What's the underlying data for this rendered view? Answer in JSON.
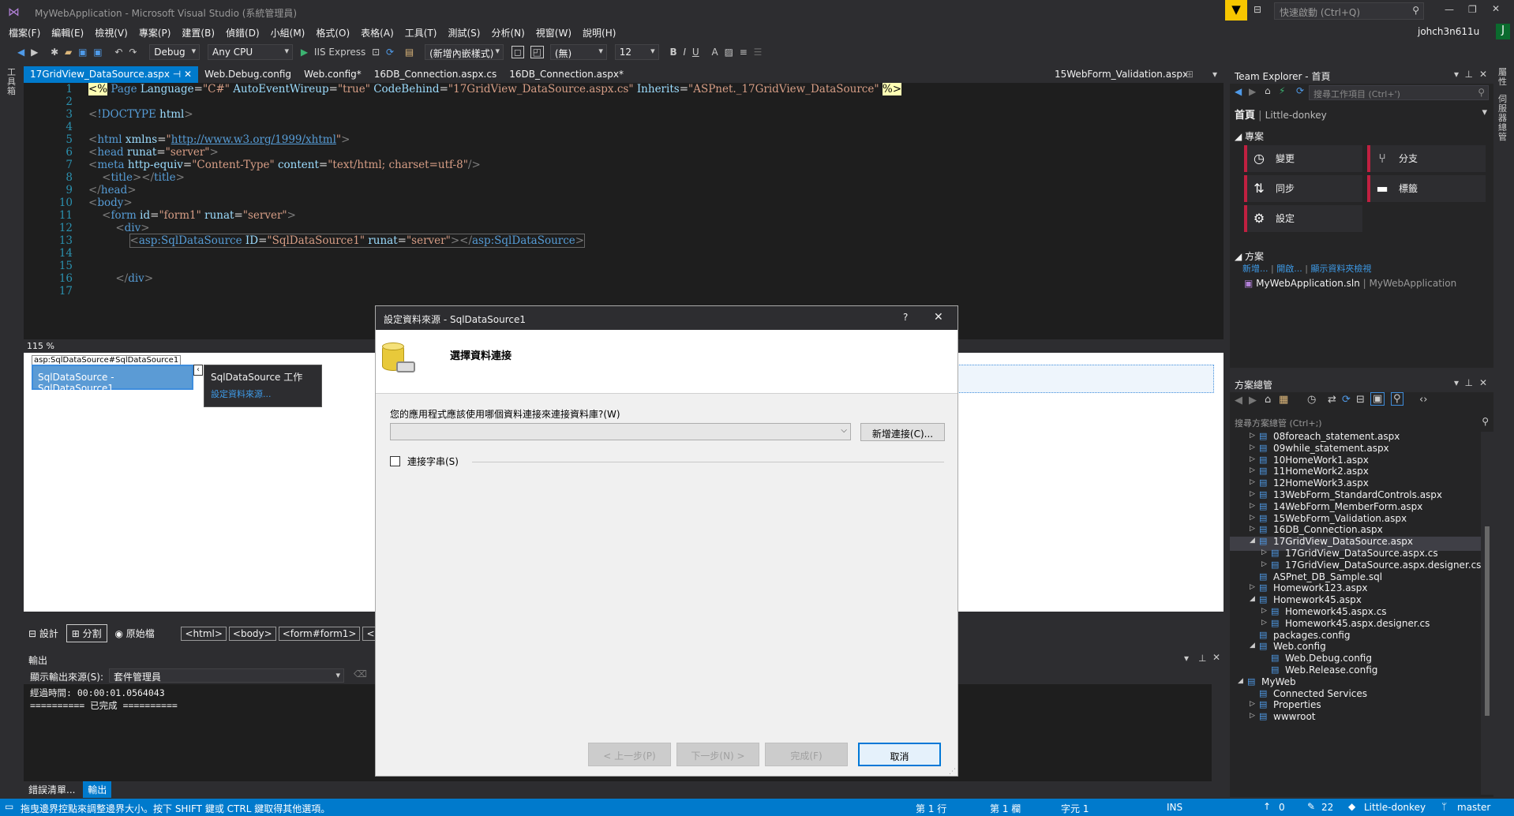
{
  "window": {
    "title": "MyWebApplication - Microsoft Visual Studio (系統管理員)",
    "quick_launch_placeholder": "快速啟動 (Ctrl+Q)",
    "user": "johch3n611u",
    "user_initial": "J"
  },
  "menu": [
    "檔案(F)",
    "編輯(E)",
    "檢視(V)",
    "專案(P)",
    "建置(B)",
    "偵錯(D)",
    "小組(M)",
    "格式(O)",
    "表格(A)",
    "工具(T)",
    "測試(S)",
    "分析(N)",
    "視窗(W)",
    "說明(H)"
  ],
  "toolbar": {
    "config": "Debug",
    "platform": "Any CPU",
    "run_target": "IIS Express",
    "style": "(新增內嵌樣式)",
    "font": "(無)",
    "size": "12",
    "bold": "B",
    "italic": "I",
    "underline": "U"
  },
  "doc_tabs": [
    {
      "label": "17GridView_DataSource.aspx",
      "active": true
    },
    {
      "label": "Web.Debug.config",
      "active": false
    },
    {
      "label": "Web.config*",
      "active": false
    },
    {
      "label": "16DB_Connection.aspx.cs",
      "active": false
    },
    {
      "label": "16DB_Connection.aspx*",
      "active": false
    }
  ],
  "doc_tab_right": "15WebForm_Validation.aspx",
  "editor": {
    "line_numbers": [
      "1",
      "2",
      "3",
      "4",
      "5",
      "6",
      "7",
      "8",
      "9",
      "10",
      "11",
      "12",
      "13",
      "14",
      "15",
      "16",
      "17"
    ],
    "zoom": "115 %"
  },
  "design": {
    "tag_label": "asp:SqlDataSource#SqlDataSource1",
    "control_label": "SqlDataSource - SqlDataSource1",
    "smart_tag_title": "SqlDataSource 工作",
    "smart_tag_link": "設定資料來源..."
  },
  "view_tabs": {
    "design": "設計",
    "split": "分割",
    "source": "原始檔",
    "crumbs": [
      "<html>",
      "<body>",
      "<form#form1>",
      "<"
    ]
  },
  "output": {
    "title": "輸出",
    "source_label": "顯示輸出來源(S):",
    "source_value": "套件管理員",
    "lines": [
      "經過時間: 00:00:01.0564043",
      "========== 已完成 =========="
    ]
  },
  "bottom_tabs": [
    "錯誤清單...",
    "輸出"
  ],
  "status": {
    "message": "拖曳邊界控點來調整邊界大小。按下 SHIFT 鍵或 CTRL 鍵取得其他選項。",
    "line": "第 1 行",
    "col": "第 1 欄",
    "char": "字元 1",
    "ins": "INS",
    "up": "0",
    "pencil": "22",
    "repo": "Little-donkey",
    "branch": "master"
  },
  "team_explorer": {
    "title": "Team Explorer - 首頁",
    "search_placeholder": "搜尋工作項目 (Ctrl+')",
    "home": "首頁",
    "repo": "Little-donkey",
    "project_section": "專案",
    "tiles": [
      {
        "icon": "changes-icon",
        "label": "變更"
      },
      {
        "icon": "branch-icon",
        "label": "分支"
      },
      {
        "icon": "sync-icon",
        "label": "同步"
      },
      {
        "icon": "tag-icon",
        "label": "標籤"
      },
      {
        "icon": "settings-icon",
        "label": "設定"
      }
    ],
    "solution_section": "方案",
    "links": [
      "新增...",
      "開啟...",
      "顯示資料夾檢視"
    ],
    "solution_name": "MyWebApplication.sln",
    "solution_folder": "MyWebApplication"
  },
  "solution_explorer": {
    "title": "方案總管",
    "search_placeholder": "搜尋方案總管 (Ctrl+;)",
    "items": [
      {
        "label": "08foreach_statement.aspx",
        "level": 1,
        "expander": "▷",
        "selected": false
      },
      {
        "label": "09while_statement.aspx",
        "level": 1,
        "expander": "▷",
        "selected": false
      },
      {
        "label": "10HomeWork1.aspx",
        "level": 1,
        "expander": "▷",
        "selected": false
      },
      {
        "label": "11HomeWork2.aspx",
        "level": 1,
        "expander": "▷",
        "selected": false
      },
      {
        "label": "12HomeWork3.aspx",
        "level": 1,
        "expander": "▷",
        "selected": false
      },
      {
        "label": "13WebForm_StandardControls.aspx",
        "level": 1,
        "expander": "▷",
        "selected": false
      },
      {
        "label": "14WebForm_MemberForm.aspx",
        "level": 1,
        "expander": "▷",
        "selected": false
      },
      {
        "label": "15WebForm_Validation.aspx",
        "level": 1,
        "expander": "▷",
        "selected": false
      },
      {
        "label": "16DB_Connection.aspx",
        "level": 1,
        "expander": "▷",
        "selected": false
      },
      {
        "label": "17GridView_DataSource.aspx",
        "level": 1,
        "expander": "◢",
        "selected": true
      },
      {
        "label": "17GridView_DataSource.aspx.cs",
        "level": 2,
        "expander": "▷",
        "selected": false
      },
      {
        "label": "17GridView_DataSource.aspx.designer.cs",
        "level": 2,
        "expander": "▷",
        "selected": false
      },
      {
        "label": "ASPnet_DB_Sample.sql",
        "level": 1,
        "expander": "",
        "selected": false
      },
      {
        "label": "Homework123.aspx",
        "level": 1,
        "expander": "▷",
        "selected": false
      },
      {
        "label": "Homework45.aspx",
        "level": 1,
        "expander": "◢",
        "selected": false
      },
      {
        "label": "Homework45.aspx.cs",
        "level": 2,
        "expander": "▷",
        "selected": false
      },
      {
        "label": "Homework45.aspx.designer.cs",
        "level": 2,
        "expander": "▷",
        "selected": false
      },
      {
        "label": "packages.config",
        "level": 1,
        "expander": "",
        "selected": false
      },
      {
        "label": "Web.config",
        "level": 1,
        "expander": "◢",
        "selected": false
      },
      {
        "label": "Web.Debug.config",
        "level": 2,
        "expander": "",
        "selected": false
      },
      {
        "label": "Web.Release.config",
        "level": 2,
        "expander": "",
        "selected": false
      },
      {
        "label": "MyWeb",
        "level": 0,
        "expander": "◢",
        "selected": false
      },
      {
        "label": "Connected Services",
        "level": 1,
        "expander": "",
        "selected": false
      },
      {
        "label": "Properties",
        "level": 1,
        "expander": "▷",
        "selected": false
      },
      {
        "label": "wwwroot",
        "level": 1,
        "expander": "▷",
        "selected": false
      }
    ]
  },
  "side_strip_left": "工具箱",
  "side_strip_right": [
    "屬性",
    "伺服器總管"
  ],
  "dialog": {
    "title": "設定資料來源 - SqlDataSource1",
    "help": "?",
    "heading": "選擇資料連接",
    "question": "您的應用程式應該使用哪個資料連接來連接資料庫?(W)",
    "combo_value": "",
    "new_conn_button": "新增連接(C)...",
    "conn_string_label": "連接字串(S)",
    "prev_button": "< 上一步(P)",
    "next_button": "下一步(N) >",
    "finish_button": "完成(F)",
    "cancel_button": "取消"
  }
}
